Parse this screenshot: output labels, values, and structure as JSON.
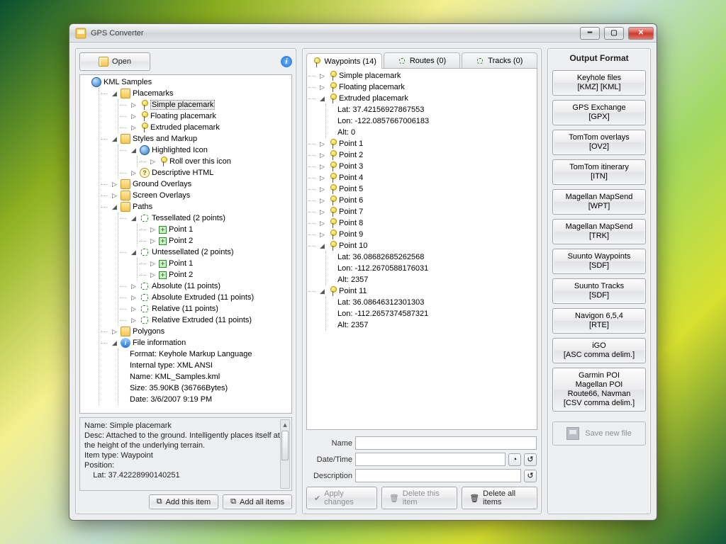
{
  "window": {
    "title": "GPS Converter"
  },
  "toolbar": {
    "open": "Open"
  },
  "tree_root": "KML Samples",
  "placemarks": {
    "label": "Placemarks",
    "items": [
      "Simple placemark",
      "Floating placemark",
      "Extruded placemark"
    ]
  },
  "styles": {
    "label": "Styles and Markup",
    "highlighted": "Highlighted Icon",
    "roll": "Roll over this icon",
    "desc_html": "Descriptive HTML"
  },
  "ground": "Ground Overlays",
  "screen": "Screen Overlays",
  "paths": {
    "label": "Paths",
    "tess": {
      "label": "Tessellated (2 points)",
      "p1": "Point 1",
      "p2": "Point 2"
    },
    "untess": {
      "label": "Untessellated (2 points)",
      "p1": "Point 1",
      "p2": "Point 2"
    },
    "abs": "Absolute (11 points)",
    "absx": "Absolute Extruded (11 points)",
    "rel": "Relative (11 points)",
    "relx": "Relative Extruded (11 points)"
  },
  "polygons": "Polygons",
  "fileinfo": {
    "label": "File information",
    "format": "Format: Keyhole Markup Language",
    "internal": "Internal type: XML ANSI",
    "name": "Name: KML_Samples.kml",
    "size": "Size: 35.90KB (36766Bytes)",
    "date": "Date: 3/6/2007 9:19 PM"
  },
  "details": {
    "name": "Name: Simple placemark",
    "desc": "Desc: Attached to the ground. Intelligently places itself at the height of the underlying terrain.",
    "itemtype": "Item type: Waypoint",
    "position": "Position:",
    "lat": "    Lat: 37.42228990140251"
  },
  "btns": {
    "add_this": "Add this item",
    "add_all": "Add all items",
    "apply": "Apply changes",
    "del_this": "Delete this item",
    "del_all": "Delete all items"
  },
  "tabs": {
    "waypoints": "Waypoints (14)",
    "routes": "Routes (0)",
    "tracks": "Tracks (0)"
  },
  "wp": {
    "simple": "Simple placemark",
    "floating": "Floating placemark",
    "extruded": {
      "label": "Extruded placemark",
      "lat": "Lat: 37.42156927867553",
      "lon": "Lon: -122.0857667006183",
      "alt": "Alt: 0"
    },
    "points": [
      "Point 1",
      "Point 2",
      "Point 3",
      "Point 4",
      "Point 5",
      "Point 6",
      "Point 7",
      "Point 8",
      "Point 9"
    ],
    "p10": {
      "label": "Point 10",
      "lat": "Lat: 36.08682685262568",
      "lon": "Lon: -112.2670588176031",
      "alt": "Alt: 2357"
    },
    "p11": {
      "label": "Point 11",
      "lat": "Lat: 36.08646312301303",
      "lon": "Lon: -112.2657374587321",
      "alt": "Alt: 2357"
    }
  },
  "fields": {
    "name": "Name",
    "datetime": "Date/Time",
    "description": "Description"
  },
  "output": {
    "heading": "Output Format",
    "save": "Save new file",
    "formats": [
      "Keyhole files\n[KMZ]  [KML]",
      "GPS Exchange\n[GPX]",
      "TomTom overlays\n[OV2]",
      "TomTom itinerary\n[ITN]",
      "Magellan MapSend\n[WPT]",
      "Magellan MapSend\n[TRK]",
      "Suunto Waypoints\n[SDF]",
      "Suunto Tracks\n[SDF]",
      "Navigon 6,5,4\n[RTE]",
      "iGO\n[ASC comma delim.]",
      "Garmin POI\nMagellan POI\nRoute66, Navman\n[CSV comma delim.]"
    ]
  }
}
